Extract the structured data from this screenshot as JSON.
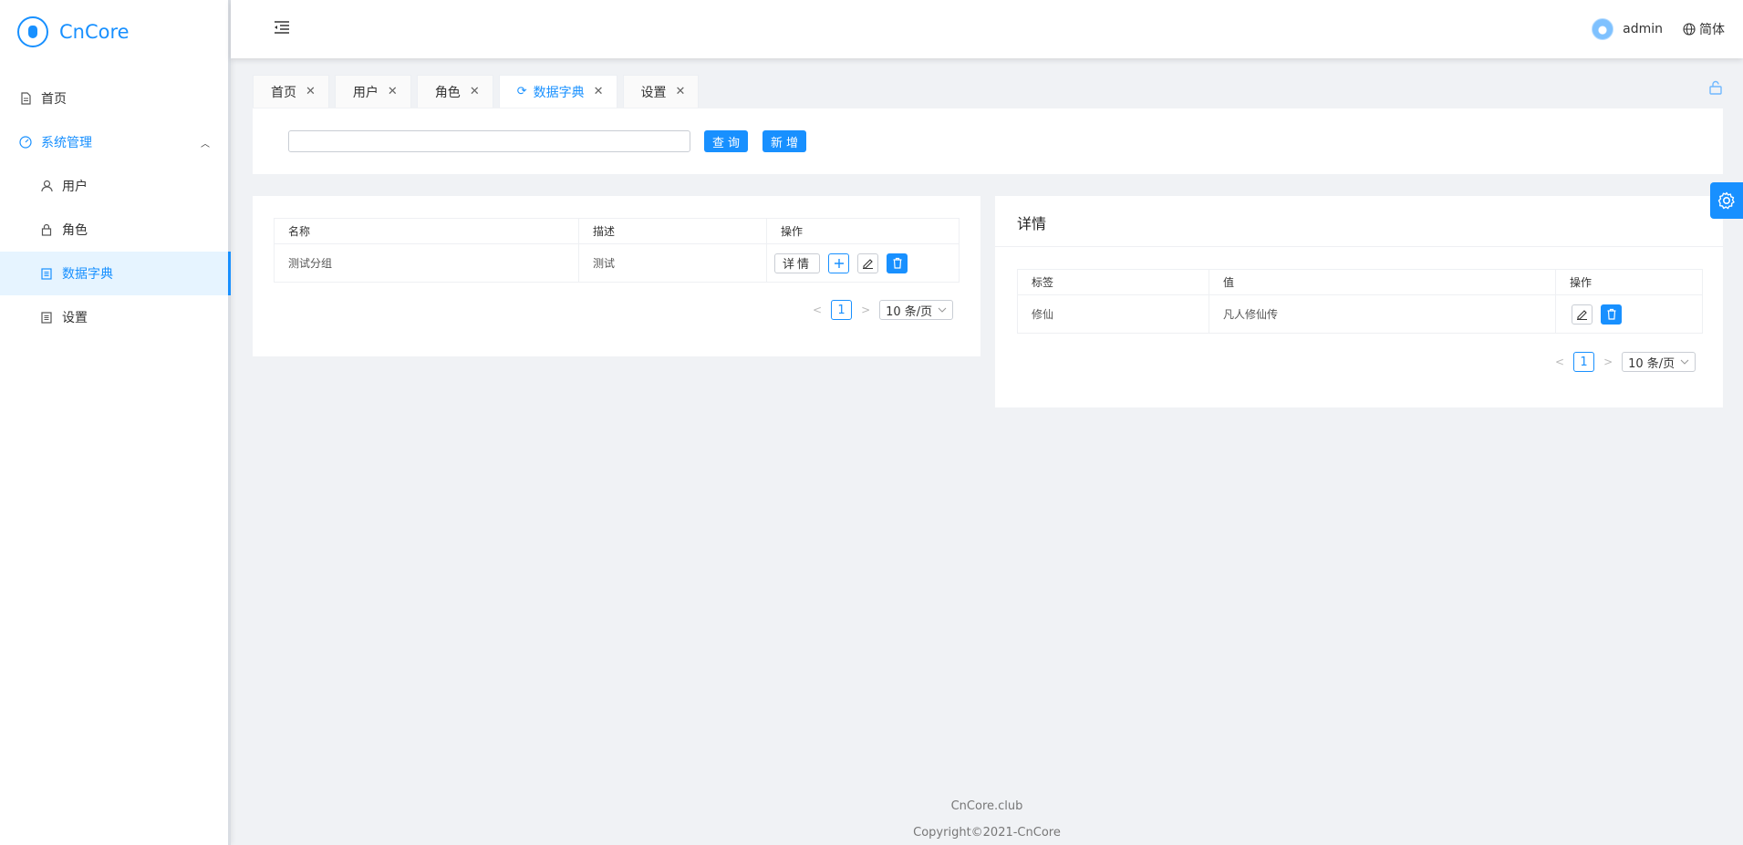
{
  "app": {
    "name": "CnCore"
  },
  "sidebar": {
    "items": [
      {
        "label": "首页"
      },
      {
        "label": "系统管理"
      },
      {
        "label": "用户"
      },
      {
        "label": "角色"
      },
      {
        "label": "数据字典"
      },
      {
        "label": "设置"
      }
    ]
  },
  "header": {
    "user": "admin",
    "language": "简体"
  },
  "tabs": [
    {
      "label": "首页"
    },
    {
      "label": "用户"
    },
    {
      "label": "角色"
    },
    {
      "label": "数据字典"
    },
    {
      "label": "设置"
    }
  ],
  "search": {
    "value": "",
    "placeholder": "",
    "query_label": "查询",
    "add_label": "新增"
  },
  "dict_table": {
    "columns": [
      "名称",
      "描述",
      "操作"
    ],
    "rows": [
      {
        "name": "测试分组",
        "desc": "测试",
        "detail_label": "详情"
      }
    ],
    "pagination": {
      "page": "1",
      "page_size": "10 条/页"
    }
  },
  "detail": {
    "title": "详情",
    "columns": [
      "标签",
      "值",
      "操作"
    ],
    "rows": [
      {
        "label": "修仙",
        "value": "凡人修仙传"
      }
    ],
    "pagination": {
      "page": "1",
      "page_size": "10 条/页"
    }
  },
  "footer": {
    "site": "CnCore.club",
    "copyright": "Copyright©2021-CnCore"
  },
  "colors": {
    "primary": "#1890ff",
    "background": "#f0f2f5"
  }
}
